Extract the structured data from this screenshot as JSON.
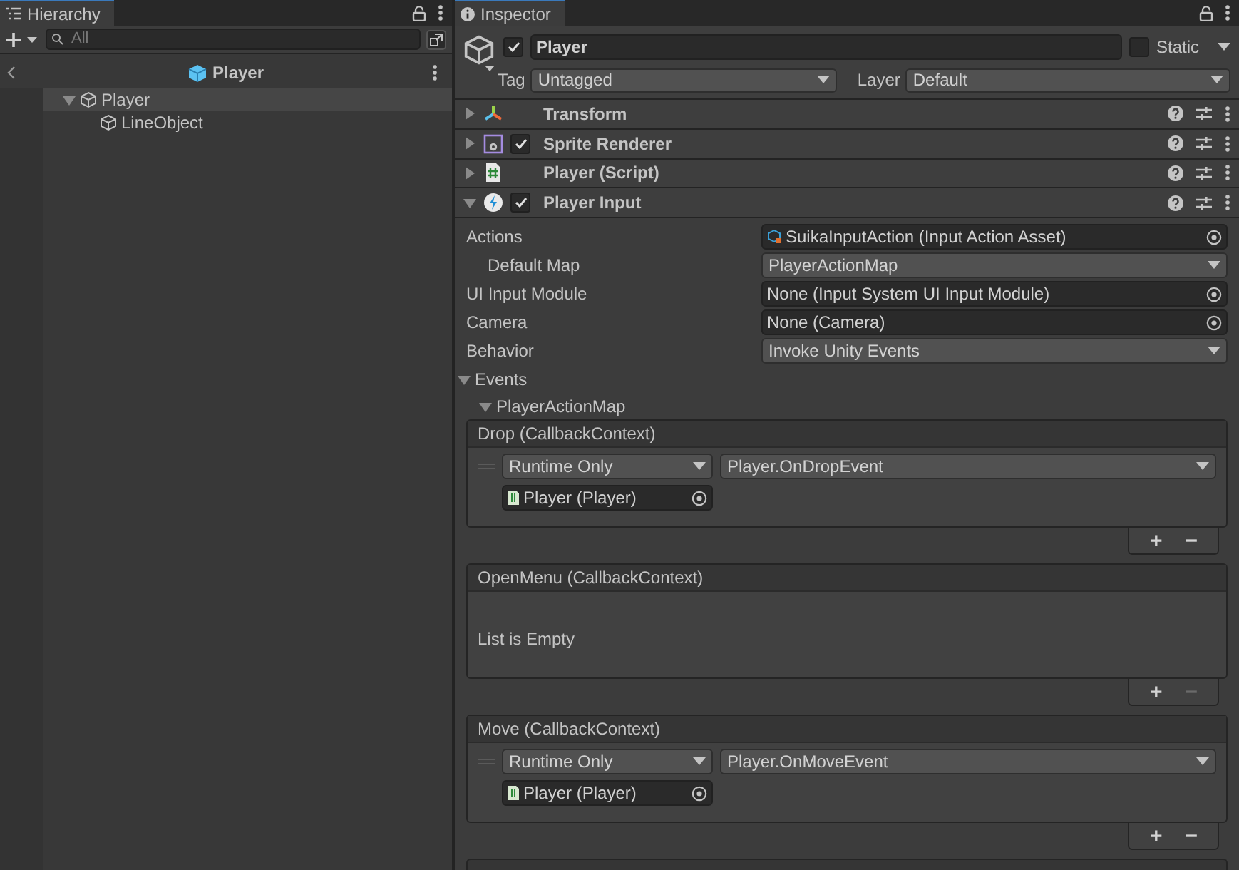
{
  "hierarchy": {
    "title": "Hierarchy",
    "search": {
      "placeholder": "All"
    },
    "scene": {
      "title": "Player"
    },
    "tree": [
      {
        "label": "Player",
        "expanded": true,
        "highlighted": true,
        "children": [
          {
            "label": "LineObject",
            "highlighted": false
          }
        ]
      }
    ]
  },
  "inspector": {
    "title": "Inspector",
    "object": {
      "active": true,
      "name": "Player",
      "static": false,
      "static_label": "Static",
      "tag_label": "Tag",
      "tag": "Untagged",
      "layer_label": "Layer",
      "layer": "Default"
    },
    "components": [
      {
        "kind": "transform",
        "name": "Transform",
        "expanded": false
      },
      {
        "kind": "sprite",
        "name": "Sprite Renderer",
        "expanded": false,
        "checked": true
      },
      {
        "kind": "script",
        "name": "Player (Script)",
        "expanded": false
      },
      {
        "kind": "input",
        "name": "Player Input",
        "expanded": true,
        "checked": true
      }
    ],
    "properties": [
      {
        "kind": "object",
        "label": "Actions",
        "value": "SuikaInputAction (Input Action Asset)",
        "asset_icon": true,
        "children": [
          {
            "kind": "dropdown",
            "label": "Default Map",
            "value": "PlayerActionMap"
          }
        ]
      },
      {
        "kind": "object",
        "label": "UI Input Module",
        "value": "None (Input System UI Input Module)",
        "asset_icon": false
      },
      {
        "kind": "object",
        "label": "Camera",
        "value": "None (Camera)",
        "asset_icon": false
      },
      {
        "kind": "dropdown",
        "label": "Behavior",
        "value": "Invoke Unity Events"
      }
    ],
    "events": {
      "label": "Events",
      "expanded": true,
      "maps": [
        {
          "label": "PlayerActionMap",
          "expanded": true,
          "events": [
            {
              "title": "Drop (CallbackContext)",
              "listeners": [
                {
                  "mode": "Runtime Only",
                  "function": "Player.OnDropEvent",
                  "target": "Player (Player)"
                }
              ],
              "add": "+",
              "remove": "−",
              "remove_enabled": true
            },
            {
              "title": "OpenMenu (CallbackContext)",
              "empty_text": "List is Empty",
              "add": "+",
              "remove": "−",
              "remove_enabled": false
            },
            {
              "title": "Move (CallbackContext)",
              "listeners": [
                {
                  "mode": "Runtime Only",
                  "function": "Player.OnMoveEvent",
                  "target": "Player (Player)"
                }
              ],
              "add": "+",
              "remove": "−",
              "remove_enabled": true
            }
          ]
        }
      ]
    }
  }
}
